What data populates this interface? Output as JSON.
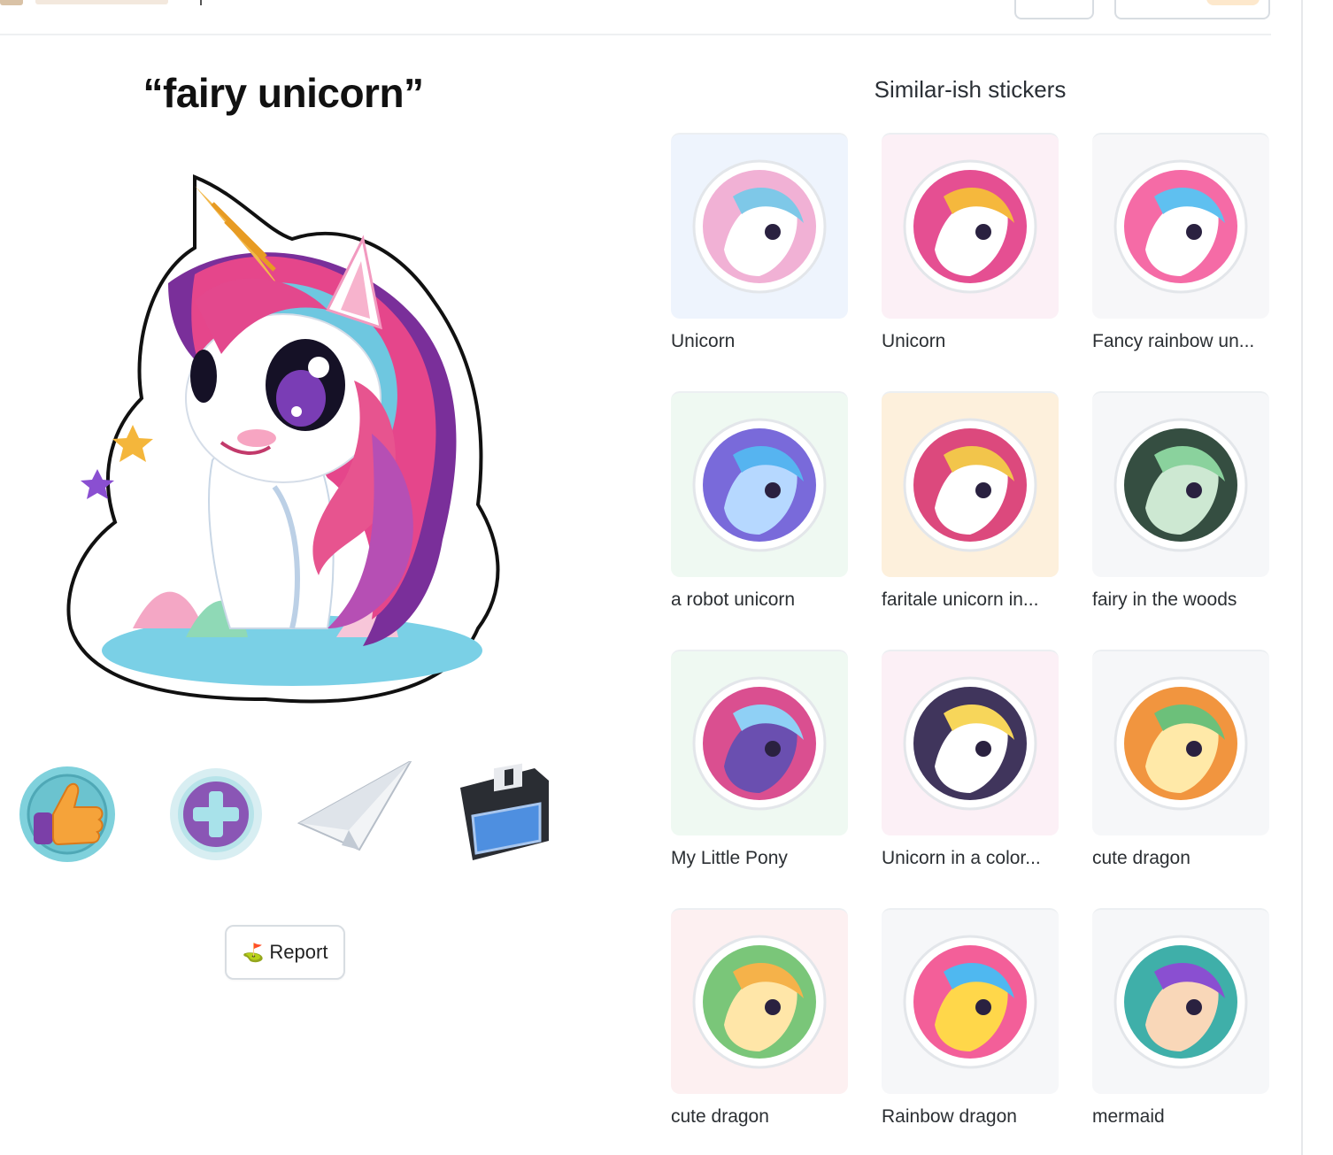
{
  "main": {
    "title": "“fairy unicorn”",
    "report_label": "Report",
    "actions": [
      {
        "name": "like",
        "icon": "thumbs-up-icon"
      },
      {
        "name": "add",
        "icon": "plus-icon"
      },
      {
        "name": "share",
        "icon": "paper-plane-icon"
      },
      {
        "name": "save",
        "icon": "floppy-disk-icon"
      }
    ]
  },
  "similar": {
    "title": "Similar-ish stickers",
    "items": [
      {
        "label": "Unicorn",
        "bg": "#eef4fd"
      },
      {
        "label": "Unicorn",
        "bg": "#fcf0f6"
      },
      {
        "label": "Fancy rainbow un...",
        "bg": "#f7f7f9"
      },
      {
        "label": "a robot unicorn",
        "bg": "#eff9f2"
      },
      {
        "label": "faritale unicorn in...",
        "bg": "#fdf0dc"
      },
      {
        "label": "fairy in the woods",
        "bg": "#f6f7f9"
      },
      {
        "label": "My Little Pony",
        "bg": "#eff9f2"
      },
      {
        "label": "Unicorn in a color...",
        "bg": "#fcf0f6"
      },
      {
        "label": "cute dragon",
        "bg": "#f6f7f9"
      },
      {
        "label": "cute dragon",
        "bg": "#fdf0f1"
      },
      {
        "label": "Rainbow dragon",
        "bg": "#f6f7f9"
      },
      {
        "label": "mermaid",
        "bg": "#f6f7f9"
      }
    ]
  }
}
